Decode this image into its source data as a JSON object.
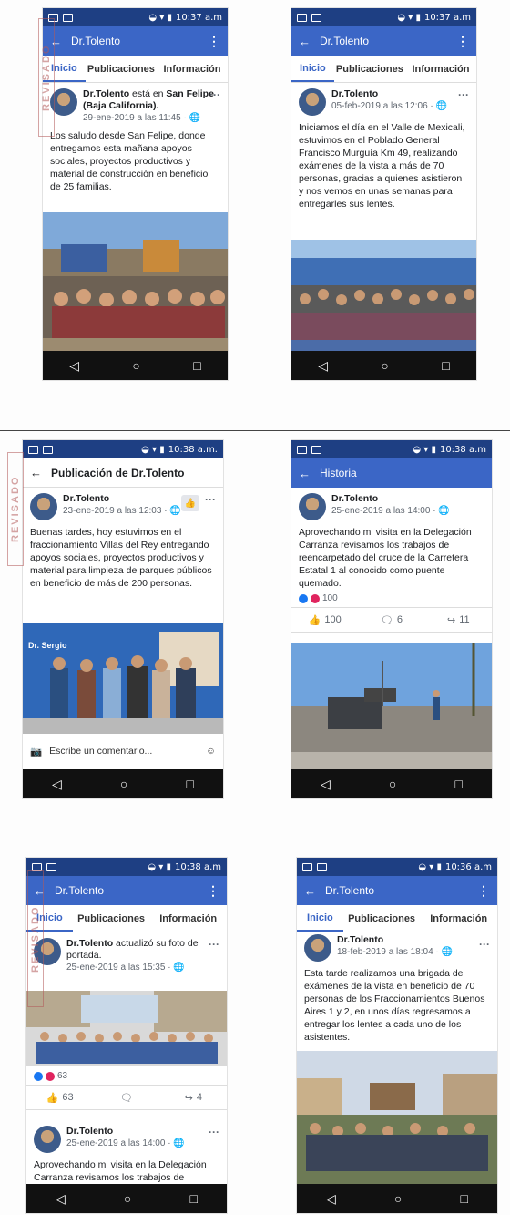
{
  "status": {
    "p1_time": "10:37 a.m",
    "p2_time": "10:37 a.m",
    "p3_time": "10:38 a.m.",
    "p4_time": "10:38 a.m",
    "p5_time": "10:38 a.m",
    "p6_time": "10:36 a.m"
  },
  "profile_tabs": {
    "home": "Inicio",
    "posts": "Publicaciones",
    "info": "Información"
  },
  "phone1": {
    "app_title": "Dr.Tolento",
    "name_prefix": "Dr.Tolento",
    "name_middle": " está en ",
    "place": "San Felipe (Baja California).",
    "date": "29-ene-2019 a las 11:45 · ",
    "text": "Los saludo desde San Felipe, donde entregamos esta mañana apoyos sociales, proyectos productivos y material de construcción en beneficio de 25 familias."
  },
  "phone2": {
    "app_title": "Dr.Tolento",
    "name": "Dr.Tolento",
    "date": "05-feb-2019 a las 12:06 · ",
    "text": "Iniciamos el día en el Valle de Mexicali, estuvimos en el Poblado General Francisco Murguía Km 49, realizando exámenes de la vista a más de 70 personas, gracias a quienes asistieron y nos vemos en unas semanas para entregarles sus lentes."
  },
  "phone3": {
    "app_title": "Publicación de Dr.Tolento",
    "name": "Dr.Tolento",
    "date": "23-ene-2019 a las 12:03 · ",
    "text": "Buenas tardes, hoy estuvimos en el fraccionamiento Villas del Rey entregando apoyos sociales, proyectos productivos y material para limpieza de parques públicos en beneficio de más de 200 personas.",
    "banner_text": "Dr. Sergio",
    "comment_placeholder": "Escribe un comentario..."
  },
  "phone4": {
    "app_title": "Historia",
    "name": "Dr.Tolento",
    "date": "25-ene-2019 a las 14:00 · ",
    "text": "Aprovechando mi visita en la Delegación Carranza revisamos los trabajos de reencarpetado del cruce de la Carretera Estatal 1 al conocido como puente quemado.",
    "reactions": "100",
    "likes": "100",
    "comments": "6",
    "shares": "11"
  },
  "phone5": {
    "app_title": "Dr.Tolento",
    "name": "Dr.Tolento",
    "action": " actualizó su foto de portada.",
    "date": "25-ene-2019 a las 15:35 · ",
    "reactions": "63",
    "likes": "63",
    "shares": "4",
    "name2": "Dr.Tolento",
    "date2": "25-ene-2019 a las 14:00 · ",
    "text2": "Aprovechando mi visita en la Delegación Carranza revisamos los trabajos de reencarpetado del cruce de la Carretera"
  },
  "phone6": {
    "app_title": "Dr.Tolento",
    "name": "Dr.Tolento",
    "date": "18-feb-2019 a las 18:04 · ",
    "text": "Esta tarde realizamos una brigada de exámenes de la vista en beneficio de 70 personas de los Fraccionamientos Buenos Aires 1 y 2, en unos días regresamos a entregar los lentes a cada uno de los asistentes."
  },
  "stamps": {
    "s1": "REVISADO",
    "s2": "REVISADO",
    "s3": "REVISADO"
  },
  "icons": {
    "back": "arrow-left-icon",
    "more": "more-vertical-icon",
    "globe": "globe-icon",
    "nav_back": "triangle-back-icon",
    "nav_home": "circle-home-icon",
    "nav_recent": "square-recent-icon"
  },
  "colors": {
    "status_bar": "#1e3f83",
    "app_bar": "#3b66c6",
    "stamp": "#b35a5a"
  }
}
